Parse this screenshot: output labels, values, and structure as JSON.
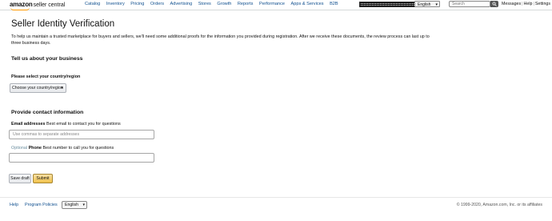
{
  "header": {
    "brand": "amazon",
    "product": "seller central",
    "nav": [
      "Catalog",
      "Inventory",
      "Pricing",
      "Orders",
      "Advertising",
      "Stores",
      "Growth",
      "Reports",
      "Performance",
      "Apps & Services",
      "B2B"
    ],
    "language": "English",
    "search_placeholder": "Search",
    "links": [
      "Messages",
      "Help",
      "Settings"
    ]
  },
  "page": {
    "title": "Seller Identity Verification",
    "intro": "To help us maintain a trusted marketplace for buyers and sellers, we'll need some additional proofs for the information you provided during registration. After we receive these documents, the review process can last up to three business days."
  },
  "business_section": {
    "heading": "Tell us about your business",
    "country_label": "Please select your country/region",
    "country_dropdown": "Choose your country/region"
  },
  "contact_section": {
    "heading": "Provide contact information",
    "email_label_bold": "Email addresses",
    "email_label_rest": " Best email to contact you for questions",
    "email_placeholder": "Use commas to separate addresses",
    "phone_label_optional": "Optional",
    "phone_label_bold": " Phone",
    "phone_label_rest": " Best number to call you for questions",
    "phone_value": ""
  },
  "actions": {
    "save_draft": "Save draft",
    "submit": "Submit"
  },
  "footer": {
    "help": "Help",
    "program_policies": "Program Policies",
    "language": "English",
    "copyright": "© 1999-2020, Amazon.com, Inc. or its affiliates"
  },
  "colors": {
    "link": "#0f4f8f",
    "submit_button": "#f0c14b",
    "logo_smile": "#ff9900"
  },
  "icons": [
    "search-icon",
    "chevron-down-icon"
  ]
}
